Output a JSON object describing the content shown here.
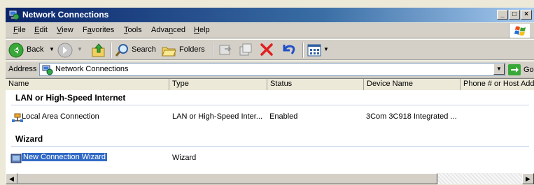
{
  "window": {
    "title": "Network Connections",
    "minimize_label": "_",
    "maximize_label": "□",
    "close_label": "×"
  },
  "menu": {
    "items": [
      {
        "first": "F",
        "rest": "ile"
      },
      {
        "first": "E",
        "rest": "dit"
      },
      {
        "first": "V",
        "rest": "iew"
      },
      {
        "first": "F",
        "rest": "avorites",
        "ul_index": 1
      },
      {
        "first": "T",
        "rest": "ools"
      },
      {
        "pre": "Adva",
        "first": "n",
        "rest": "ced"
      },
      {
        "first": "H",
        "rest": "elp"
      }
    ]
  },
  "toolbar": {
    "back_label": "Back",
    "search_label": "Search",
    "folders_label": "Folders"
  },
  "address": {
    "label": "Address",
    "value": "Network Connections",
    "go_label": "Go"
  },
  "columns": [
    "Name",
    "Type",
    "Status",
    "Device Name",
    "Phone # or Host Address"
  ],
  "groups": [
    {
      "title": "LAN or High-Speed Internet",
      "items": [
        {
          "name": "Local Area Connection",
          "type": "LAN or High-Speed Inter...",
          "status": "Enabled",
          "device": "3Com 3C918 Integrated ...",
          "phone": ""
        }
      ]
    },
    {
      "title": "Wizard",
      "items": [
        {
          "name": "New Connection Wizard",
          "type": "Wizard",
          "status": "",
          "device": "",
          "phone": ""
        }
      ]
    }
  ],
  "colors": {
    "selection": "#316ac5",
    "titlebar_start": "#0a246a"
  }
}
